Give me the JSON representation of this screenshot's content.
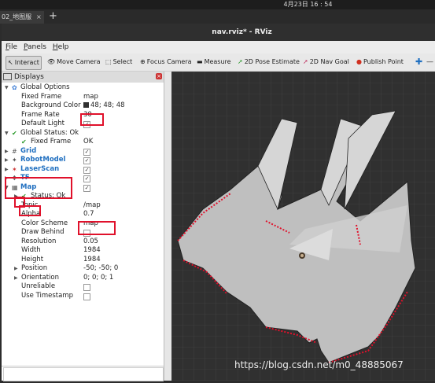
{
  "desktop": {
    "clock": "4月23日  16 : 54"
  },
  "tab": {
    "label": "02_地图服",
    "close": "×",
    "add": "+"
  },
  "window": {
    "title": "nav.rviz* - RViz"
  },
  "menu": [
    {
      "label": "File",
      "accel": "F"
    },
    {
      "label": "Panels",
      "accel": "P"
    },
    {
      "label": "Help",
      "accel": "H"
    }
  ],
  "toolbar": {
    "interact": "Interact",
    "move_camera": "Move Camera",
    "select": "Select",
    "focus_camera": "Focus Camera",
    "measure": "Measure",
    "pose_estimate": "2D Pose Estimate",
    "nav_goal": "2D Nav Goal",
    "publish_point": "Publish Point"
  },
  "displays": {
    "title": "Displays",
    "global_options": "Global Options",
    "fixed_frame_label": "Fixed Frame",
    "fixed_frame_value": "map",
    "background_color_label": "Background Color",
    "background_color_value": "48; 48; 48",
    "frame_rate_label": "Frame Rate",
    "frame_rate_value": "30",
    "default_light_label": "Default Light",
    "global_status": "Global Status: Ok",
    "fixed_frame_status_label": "Fixed Frame",
    "fixed_frame_status_value": "OK",
    "grid": "Grid",
    "robot_model": "RobotModel",
    "laser_scan": "LaserScan",
    "tf": "TF",
    "map": "Map",
    "map_status": "Status: Ok",
    "topic_label": "Topic",
    "topic_value": "/map",
    "alpha_label": "Alpha",
    "alpha_value": "0.7",
    "color_scheme_label": "Color Scheme",
    "color_scheme_value": "map",
    "draw_behind_label": "Draw Behind",
    "resolution_label": "Resolution",
    "resolution_value": "0.05",
    "width_label": "Width",
    "width_value": "1984",
    "height_label": "Height",
    "height_value": "1984",
    "position_label": "Position",
    "position_value": "-50; -50; 0",
    "orientation_label": "Orientation",
    "orientation_value": "0; 0; 0; 1",
    "unreliable_label": "Unreliable",
    "use_timestamp_label": "Use Timestamp"
  },
  "watermark": "https://blog.csdn.net/m0_48885067",
  "colors": {
    "background": "#303030",
    "laser": "#e0112b",
    "map_free": "#c8c8c8",
    "accent": "#1f6fc0"
  }
}
